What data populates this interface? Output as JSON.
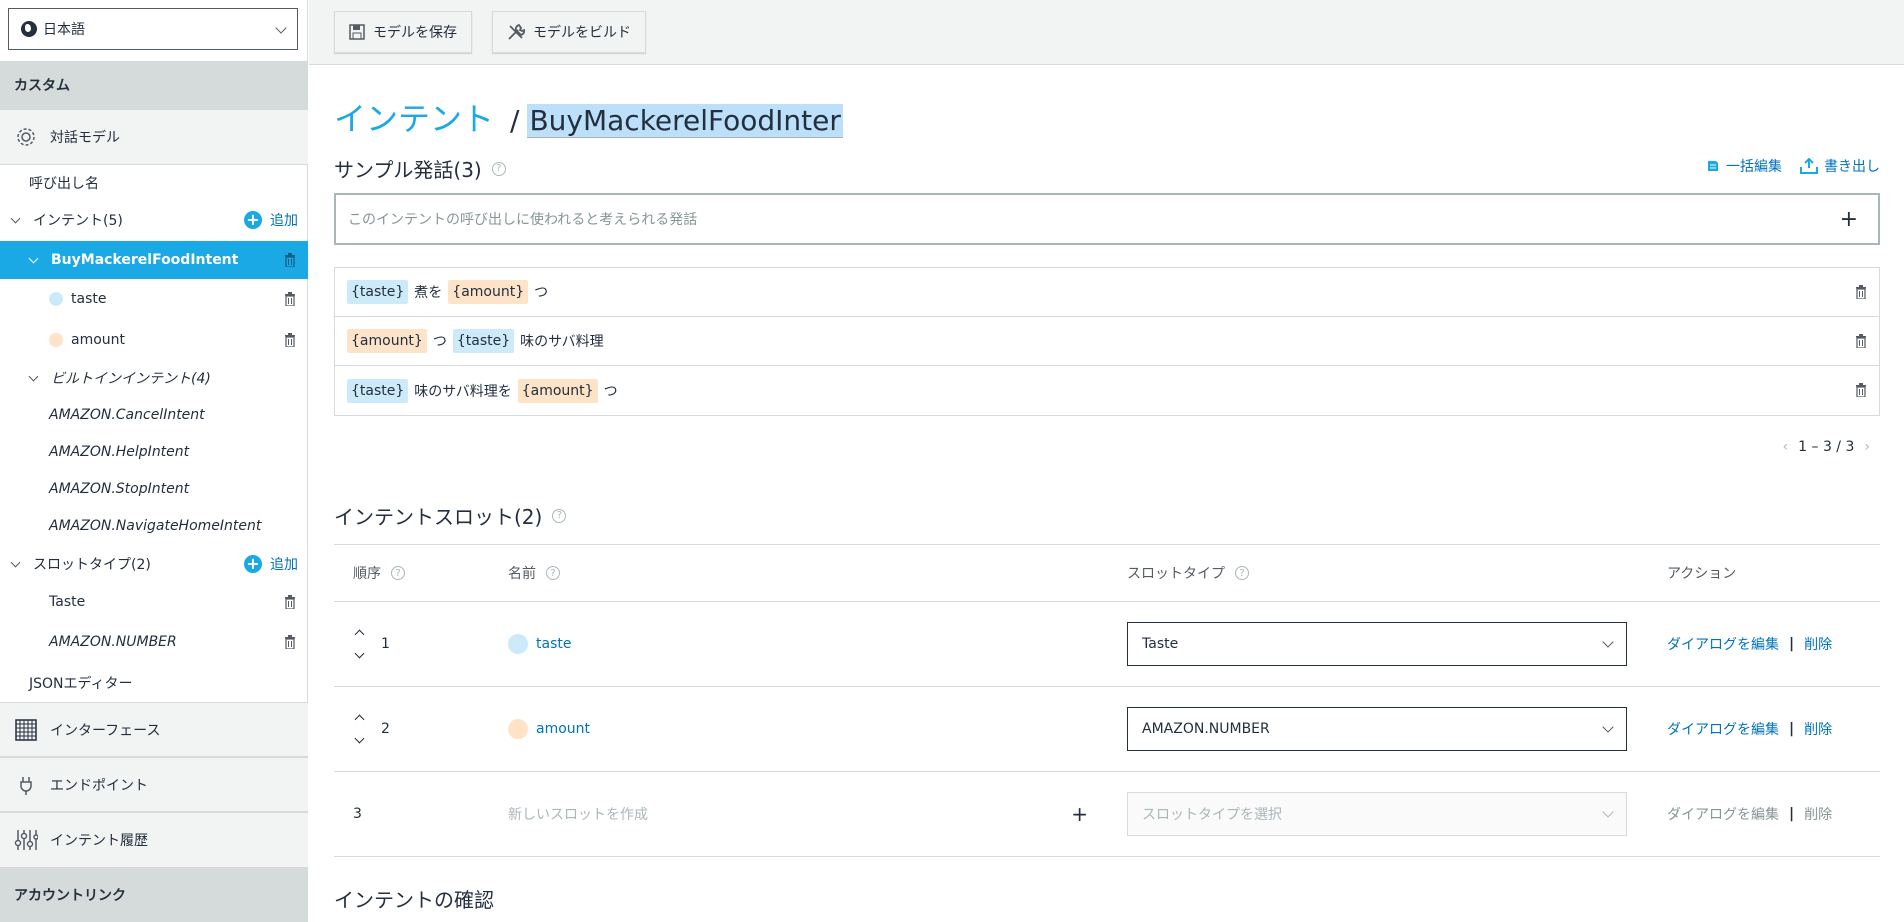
{
  "sidebar": {
    "language": "日本語",
    "custom_header": "カスタム",
    "dialog_model": "対話モデル",
    "invocation": "呼び出し名",
    "intents": {
      "label": "インテント(5)",
      "add": "追加"
    },
    "active_intent": "BuyMackerelFoodIntent",
    "slots": [
      "taste",
      "amount"
    ],
    "builtin": {
      "label": "ビルトインインテント(4)",
      "items": [
        "AMAZON.CancelIntent",
        "AMAZON.HelpIntent",
        "AMAZON.StopIntent",
        "AMAZON.NavigateHomeIntent"
      ]
    },
    "slot_types": {
      "label": "スロットタイプ(2)",
      "add": "追加",
      "items": [
        "Taste",
        "AMAZON.NUMBER"
      ]
    },
    "json_editor": "JSONエディター",
    "interfaces": "インターフェース",
    "endpoint": "エンドポイント",
    "intent_history": "インテント履歴",
    "account_link": "アカウントリンク"
  },
  "toolbar": {
    "save_label": "モデルを保存",
    "build_label": "モデルをビルド"
  },
  "main": {
    "breadcrumb_link": "インテント",
    "breadcrumb_sep": "/",
    "intent_name": "BuyMackerelFoodInter",
    "samples_title": "サンプル発話(3)",
    "bulk_edit": "一括編集",
    "export": "書き出し",
    "utter_placeholder": "このインテントの呼び出しに使われると考えられる発話",
    "utterances": [
      {
        "a": "{taste}",
        "b": "煮を",
        "c": "{amount}",
        "d": "つ"
      },
      {
        "a": "{amount}",
        "b": "つ",
        "c": "{taste}",
        "d": "味のサバ料理"
      },
      {
        "a": "{taste}",
        "b": "味のサバ料理を",
        "c": "{amount}",
        "d": "つ"
      }
    ],
    "pager": "1 – 3 / 3",
    "slots_title": "インテントスロット(2)",
    "slot_headers": {
      "order": "順序",
      "name": "名前",
      "type": "スロットタイプ",
      "action": "アクション"
    },
    "slot_rows": [
      {
        "order": "1",
        "name": "taste",
        "type": "Taste",
        "edit": "ダイアログを編集",
        "delete": "削除"
      },
      {
        "order": "2",
        "name": "amount",
        "type": "AMAZON.NUMBER",
        "edit": "ダイアログを編集",
        "delete": "削除"
      }
    ],
    "new_slot": {
      "order": "3",
      "placeholder": "新しいスロットを作成",
      "type_placeholder": "スロットタイプを選択",
      "edit": "ダイアログを編集",
      "delete": "削除"
    },
    "confirm_title": "インテントの確認"
  },
  "colors": {
    "accent": "#1aa9e5",
    "link": "#0073bb",
    "taste_chip": "#cdeafb",
    "amount_chip": "#fde4c8"
  }
}
